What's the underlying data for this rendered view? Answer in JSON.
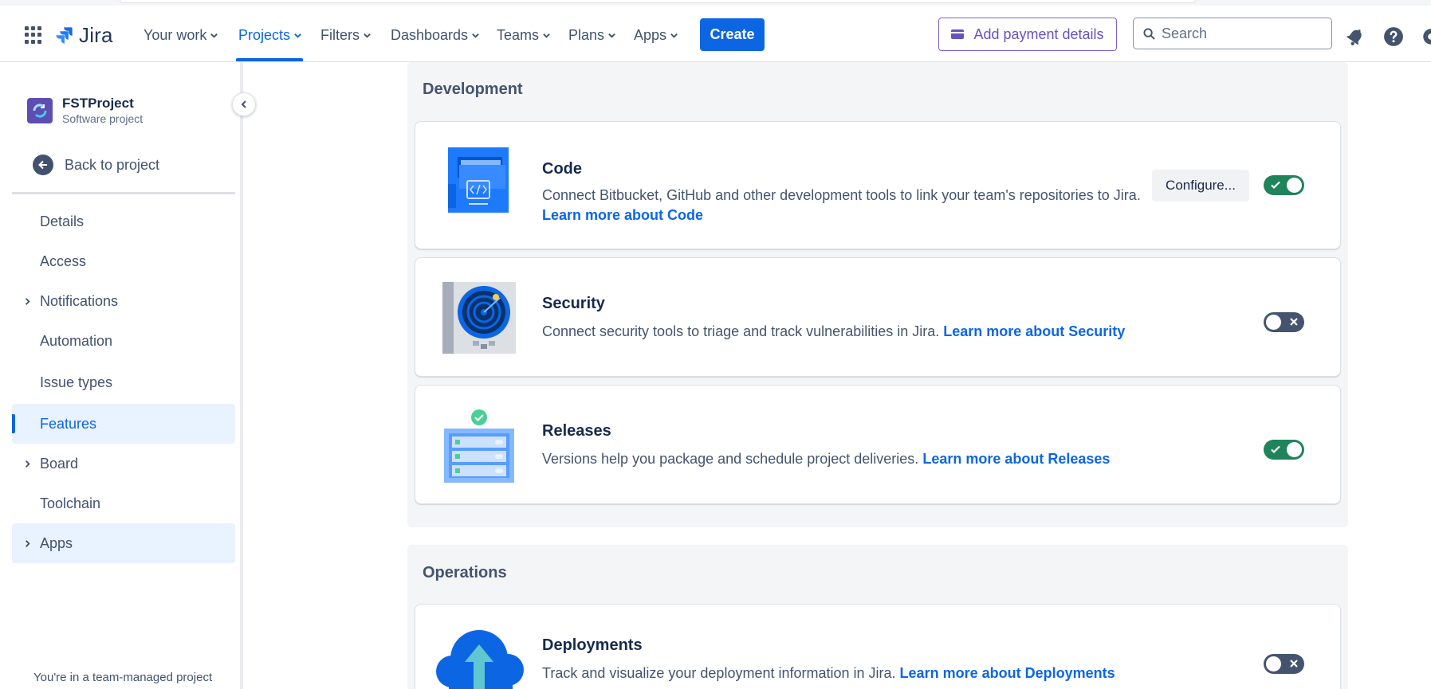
{
  "topnav": {
    "logo_text": "Jira",
    "items": [
      {
        "label": "Your work",
        "active": false
      },
      {
        "label": "Projects",
        "active": true
      },
      {
        "label": "Filters",
        "active": false
      },
      {
        "label": "Dashboards",
        "active": false
      },
      {
        "label": "Teams",
        "active": false
      },
      {
        "label": "Plans",
        "active": false
      },
      {
        "label": "Apps",
        "active": false
      }
    ],
    "create_label": "Create",
    "payment_label": "Add payment details",
    "search_placeholder": "Search",
    "icons": [
      "notifications-icon",
      "help-icon",
      "settings-icon"
    ],
    "accent_color": "#0c66e4"
  },
  "sidebar": {
    "project_name": "FSTProject",
    "project_type": "Software project",
    "back_label": "Back to project",
    "items": [
      {
        "label": "Details",
        "expandable": false
      },
      {
        "label": "Access",
        "expandable": false
      },
      {
        "label": "Notifications",
        "expandable": true
      },
      {
        "label": "Automation",
        "expandable": false
      },
      {
        "label": "Issue types",
        "expandable": false
      },
      {
        "label": "Features",
        "expandable": false,
        "selected": true
      },
      {
        "label": "Board",
        "expandable": true
      },
      {
        "label": "Toolchain",
        "expandable": false
      },
      {
        "label": "Apps",
        "expandable": true
      }
    ],
    "footer_note": "You're in a team-managed project"
  },
  "development": {
    "title": "Development",
    "features": [
      {
        "name": "Code",
        "description": "Connect Bitbucket, GitHub and other development tools to link your team's repositories to Jira.",
        "link": "Learn more about Code",
        "configure_label": "Configure...",
        "enabled": true,
        "icon": "code-folder-icon"
      },
      {
        "name": "Security",
        "description": "Connect security tools to triage and track vulnerabilities in Jira.",
        "link": "Learn more about Security",
        "enabled": false,
        "icon": "security-radar-icon"
      },
      {
        "name": "Releases",
        "description": "Versions help you package and schedule project deliveries.",
        "link": "Learn more about Releases",
        "enabled": true,
        "icon": "releases-list-icon"
      }
    ]
  },
  "operations": {
    "title": "Operations",
    "features": [
      {
        "name": "Deployments",
        "description": "Track and visualize your deployment information in Jira.",
        "link": "Learn more about Deployments",
        "enabled": false,
        "icon": "deployments-cloud-icon"
      }
    ]
  },
  "colors": {
    "toggle_on": "#1f845a",
    "toggle_off": "#44546f",
    "link": "#0c66e4",
    "payment": "#6554c0"
  }
}
